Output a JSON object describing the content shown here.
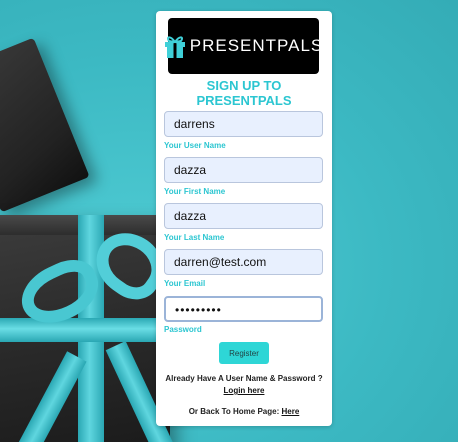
{
  "brand": {
    "logo_text": "PRESENTPALS"
  },
  "form": {
    "title_line1": "SIGN UP TO",
    "title_line2": "PRESENTPALS",
    "username": {
      "value": "darrens",
      "label": "Your User Name"
    },
    "first_name": {
      "value": "dazza",
      "label": "Your First Name"
    },
    "last_name": {
      "value": "dazza",
      "label": "Your Last Name"
    },
    "email": {
      "value": "darren@test.com",
      "label": "Your Email"
    },
    "password": {
      "value": "•••••••••",
      "label": "Password"
    },
    "register_label": "Register"
  },
  "footer": {
    "have_account_text": "Already Have A User Name & Password ?",
    "login_link": "Login here",
    "home_text": "Or Back To Home Page:",
    "home_link": "Here"
  },
  "colors": {
    "accent": "#2cc6d1",
    "button": "#2ed6d6",
    "background": "#3fbfc9"
  }
}
